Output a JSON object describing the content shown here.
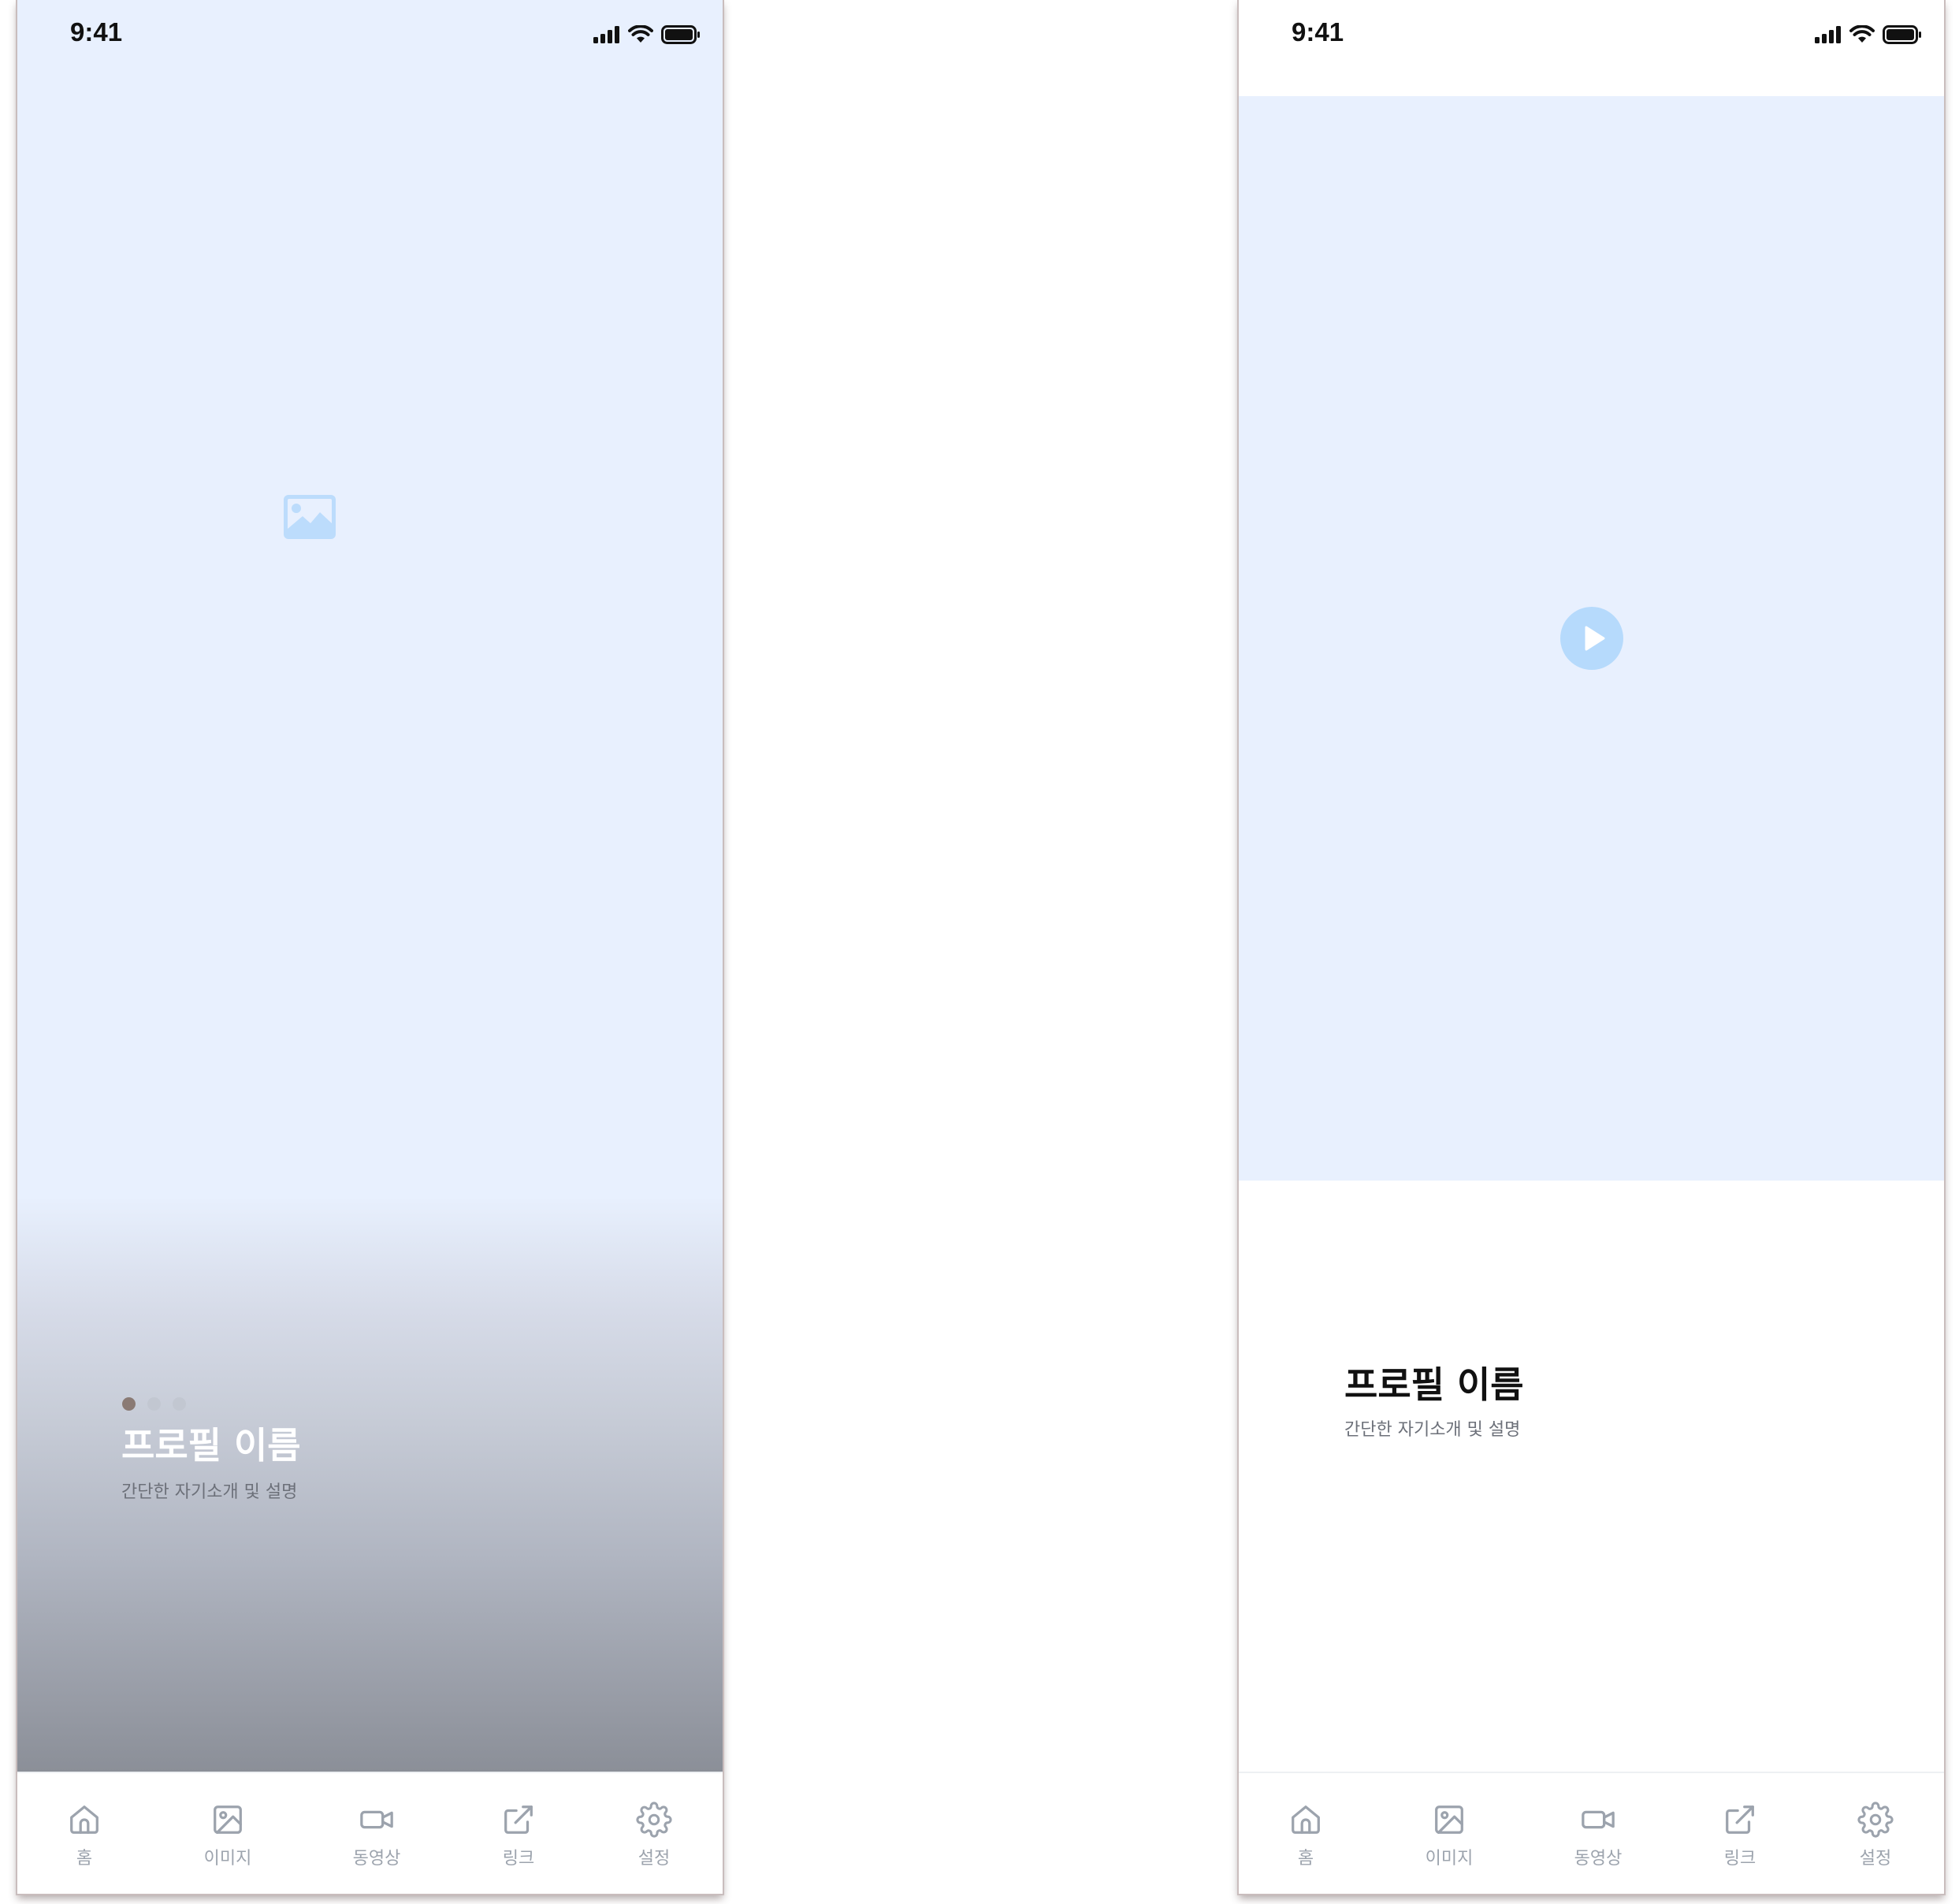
{
  "status_bar": {
    "time": "9:41",
    "icons": [
      "cellular-signal-icon",
      "wifi-icon",
      "battery-icon"
    ]
  },
  "colors": {
    "placeholder_bg": "#e8f0fe",
    "placeholder_icon": "#bcdcfc",
    "tab_icon": "#9ca3ad",
    "dot_active": "#8a7a74",
    "dot_inactive": "#c2c7d1"
  },
  "left_screen": {
    "media_icon": "image-icon",
    "carousel": {
      "count": 3,
      "active_index": 0
    },
    "profile_name": "프로필 이름",
    "profile_description": "간단한 자기소개 및 설명"
  },
  "right_screen": {
    "media_icon": "play-icon",
    "profile_name": "프로필 이름",
    "profile_description": "간단한 자기소개 및 설명"
  },
  "tab_bar": {
    "items": [
      {
        "label": "홈",
        "icon": "home-icon"
      },
      {
        "label": "이미지",
        "icon": "image-icon"
      },
      {
        "label": "동영상",
        "icon": "video-camera-icon"
      },
      {
        "label": "링크",
        "icon": "external-link-icon"
      },
      {
        "label": "설정",
        "icon": "gear-icon"
      }
    ]
  }
}
